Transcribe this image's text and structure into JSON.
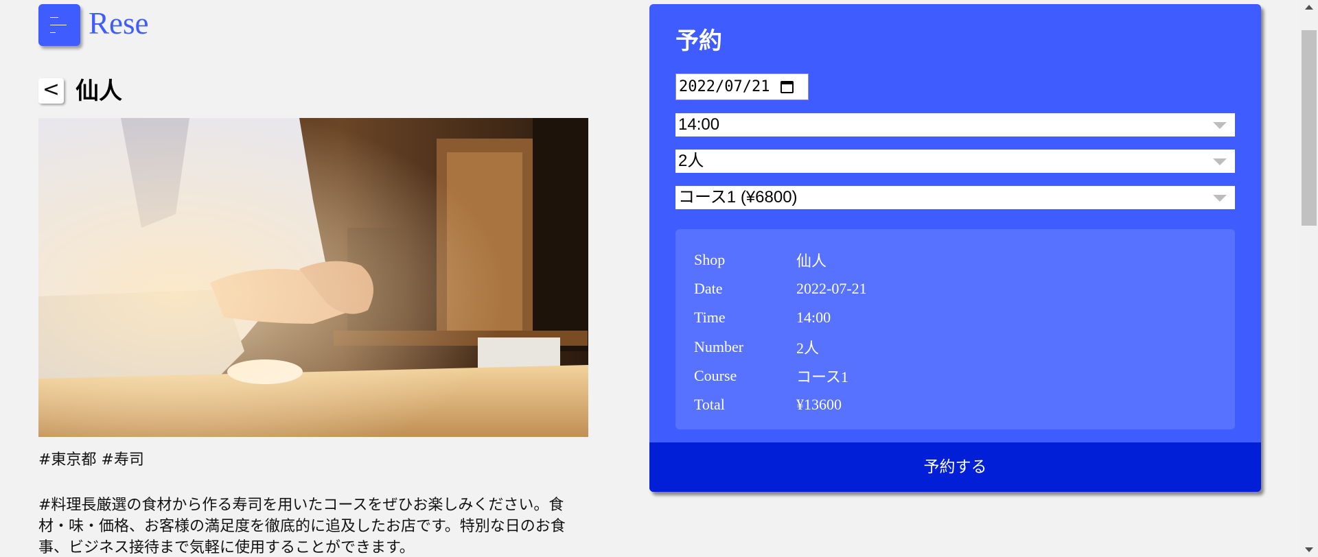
{
  "header": {
    "menu_icon": "menu-icon",
    "logo_text": "Rese"
  },
  "shop": {
    "back_label": "<",
    "name": "仙人",
    "image_alt": "sushi chef preparing sushi at counter",
    "tags": "#東京都 #寿司",
    "description": "#料理長厳選の食材から作る寿司を用いたコースをぜひお楽しみください。食材・味・価格、お客様の満足度を徹底的に追及したお店です。特別な日のお食事、ビジネス接待まで気軽に使用することができます。"
  },
  "reservation": {
    "title": "予約",
    "date_value": "2022/07/21",
    "time_value": "14:00",
    "number_value": "2人",
    "course_value": "コース1 (¥6800)",
    "summary": [
      {
        "label": "Shop",
        "value": "仙人"
      },
      {
        "label": "Date",
        "value": "2022-07-21"
      },
      {
        "label": "Time",
        "value": "14:00"
      },
      {
        "label": "Number",
        "value": "2人"
      },
      {
        "label": "Course",
        "value": "コース1"
      },
      {
        "label": "Total",
        "value": "¥13600"
      }
    ],
    "submit_label": "予約する"
  },
  "colors": {
    "accent": "#3e5cff",
    "summary_bg": "#5772ff",
    "submit_bg": "#001fd6"
  }
}
